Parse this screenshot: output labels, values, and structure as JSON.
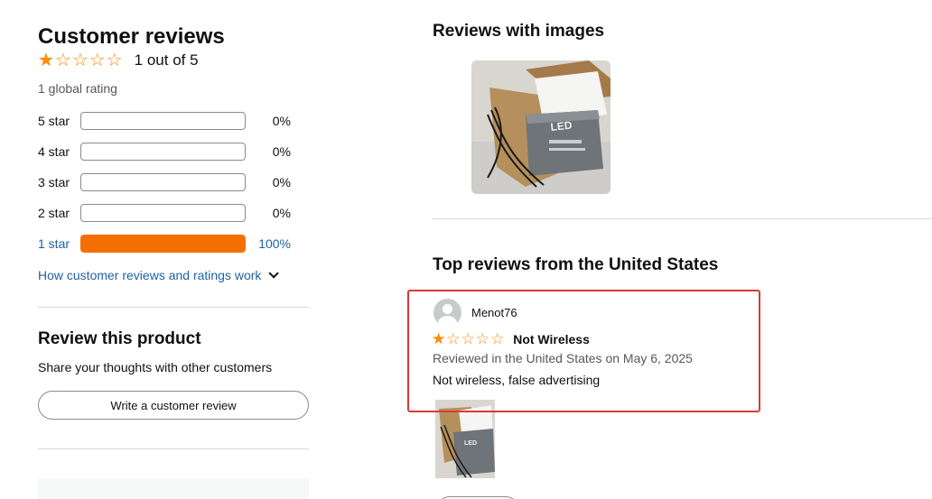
{
  "summary": {
    "title": "Customer reviews",
    "average_rating": 1,
    "max_rating": 5,
    "average_text": "1 out of 5",
    "global_rating_text": "1 global rating",
    "star_glyph": "☆",
    "star_color": "#ff8c0a"
  },
  "histogram": [
    {
      "label": "5 star",
      "percent_text": "0%",
      "value": 0
    },
    {
      "label": "4 star",
      "percent_text": "0%",
      "value": 0
    },
    {
      "label": "3 star",
      "percent_text": "0%",
      "value": 0
    },
    {
      "label": "2 star",
      "percent_text": "0%",
      "value": 0
    },
    {
      "label": "1 star",
      "percent_text": "100%",
      "value": 1
    }
  ],
  "histogram_fill_color": "#f46f00",
  "link_color": "#2162a1",
  "how_link": "How customer reviews and ratings work",
  "review_product": {
    "title": "Review this product",
    "subtitle": "Share your thoughts with other customers",
    "button": "Write a customer review"
  },
  "reviews_with_images": {
    "title": "Reviews with images",
    "image_icon": "product-photo"
  },
  "top_reviews": {
    "title": "Top reviews from the United States",
    "highlight_color": "#d93a33",
    "review": {
      "author": "Menot76",
      "rating": 1,
      "title": "Not Wireless",
      "meta": "Reviewed in the United States on May 6, 2025",
      "body": "Not wireless, false advertising",
      "avatar_icon": "default-user-avatar"
    }
  }
}
